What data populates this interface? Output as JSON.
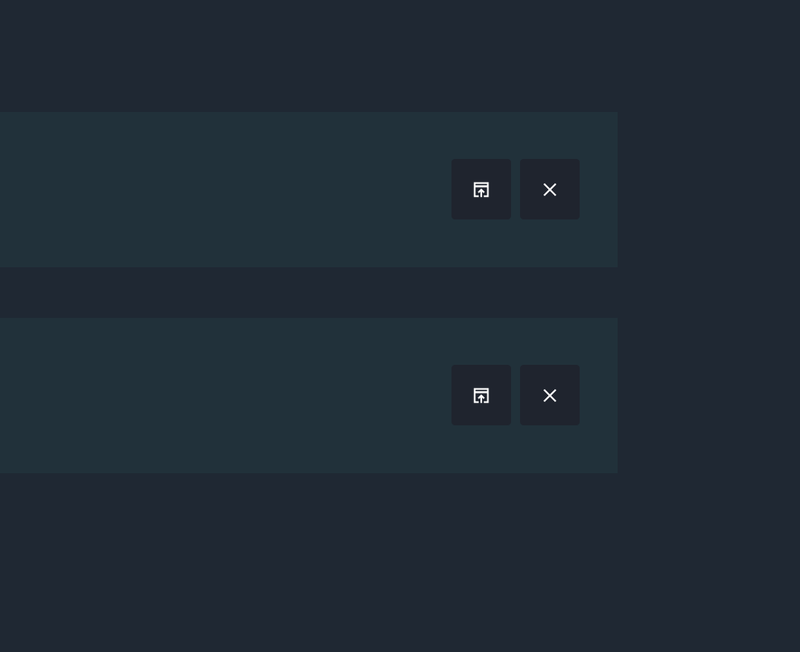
{
  "colors": {
    "background": "#1f2833",
    "panel": "#21313a",
    "button": "#1f242e",
    "icon": "#ffffff"
  },
  "items": [
    {
      "actions": [
        {
          "icon": "open-in-new-icon"
        },
        {
          "icon": "close-icon"
        }
      ]
    },
    {
      "actions": [
        {
          "icon": "open-in-new-icon"
        },
        {
          "icon": "close-icon"
        }
      ]
    }
  ]
}
